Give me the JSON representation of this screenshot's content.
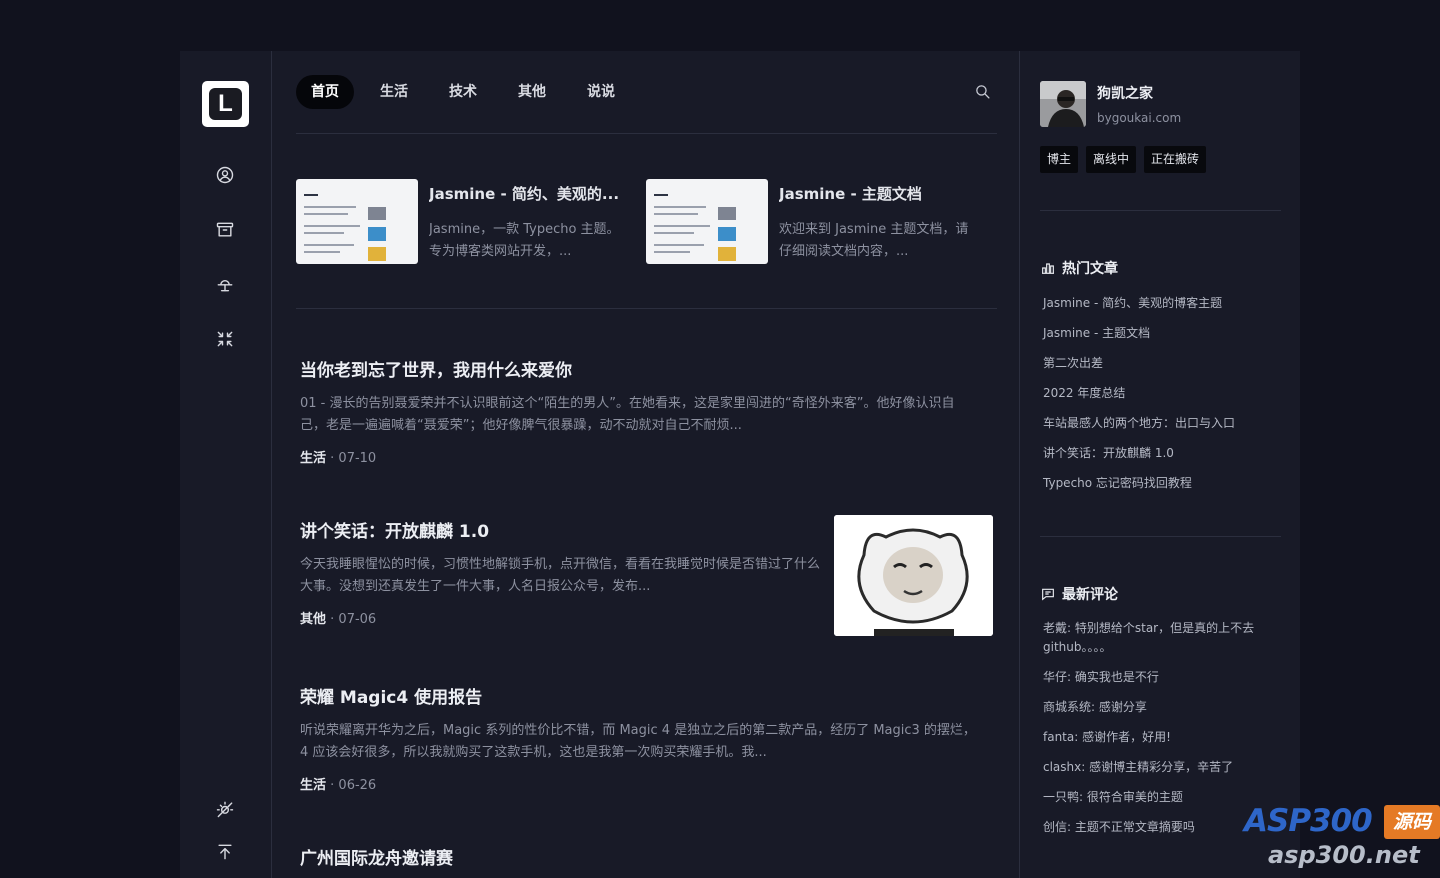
{
  "brand": {
    "logo_letter": "L"
  },
  "nav": {
    "items": [
      "首页",
      "生活",
      "技术",
      "其他",
      "说说"
    ],
    "active_index": 0
  },
  "featured": [
    {
      "title": "Jasmine - 简约、美观的...",
      "desc": "Jasmine，一款 Typecho 主题。专为博客类网站开发，..."
    },
    {
      "title": "Jasmine - 主题文档",
      "desc": "欢迎来到 Jasmine 主题文档，请仔细阅读文档内容，..."
    }
  ],
  "posts": [
    {
      "title": "当你老到忘了世界，我用什么来爱你",
      "desc": "01 - 漫长的告别聂爱荣并不认识眼前这个“陌生的男人”。在她看来，这是家里闯进的“奇怪外来客”。他好像认识自己，老是一遍遍喊着“聂爱荣”；他好像脾气很暴躁，动不动就对自己不耐烦...",
      "category": "生活",
      "date": "· 07-10"
    },
    {
      "title": "讲个笑话：开放麒麟 1.0",
      "desc": "今天我睡眼惺忪的时候，习惯性地解锁手机，点开微信，看看在我睡觉时候是否错过了什么大事。没想到还真发生了一件大事，人名日报公众号，发布...",
      "category": "其他",
      "date": "· 07-06"
    },
    {
      "title": "荣耀 Magic4 使用报告",
      "desc": "听说荣耀离开华为之后，Magic 系列的性价比不错，而 Magic 4 是独立之后的第二款产品，经历了 Magic3 的摆烂，4 应该会好很多，所以我就购买了这款手机，这也是我第一次购买荣耀手机。我...",
      "category": "生活",
      "date": "· 06-26"
    },
    {
      "title": "广州国际龙舟邀请赛"
    }
  ],
  "profile": {
    "name": "狗凯之家",
    "site": "bygoukai.com",
    "badges": [
      "博主",
      "离线中",
      "正在搬砖"
    ]
  },
  "hot": {
    "title": "热门文章",
    "items": [
      "Jasmine - 简约、美观的博客主题",
      "Jasmine - 主题文档",
      "第二次出差",
      "2022 年度总结",
      "车站最感人的两个地方：出口与入口",
      "讲个笑话：开放麒麟 1.0",
      "Typecho 忘记密码找回教程"
    ]
  },
  "comments": {
    "title": "最新评论",
    "items": [
      "老戴: 特别想给个star，但是真的上不去github。。。。",
      "华仔: 确实我也是不行",
      "商城系统: 感谢分享",
      "fanta: 感谢作者，好用!",
      "clashx: 感谢博主精彩分享，辛苦了",
      "一只鸭: 很符合审美的主题",
      "创信: 主题不正常文章摘要吗"
    ]
  },
  "watermark": {
    "brand": "ASP300",
    "tag": "源码",
    "url": "asp300.net"
  }
}
